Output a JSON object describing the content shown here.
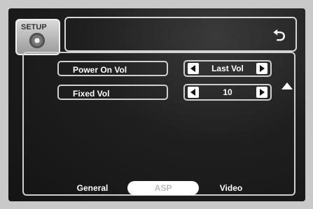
{
  "setup_tab": {
    "label": "SETUP",
    "icon": "disc-icon"
  },
  "back_icon": "return-arrow-icon",
  "rows": [
    {
      "label": "Power On Vol",
      "value": "Last Vol"
    },
    {
      "label": "Fixed Vol",
      "value": "10"
    }
  ],
  "tabs": [
    {
      "label": "General",
      "selected": false
    },
    {
      "label": "ASP",
      "selected": true
    },
    {
      "label": "Video",
      "selected": false
    }
  ],
  "colors": {
    "background": "#181818",
    "border": "#d0d0d0",
    "text": "#ffffff",
    "selected_tab_bg": "#ffffff",
    "selected_tab_text": "#bdbdbd"
  }
}
